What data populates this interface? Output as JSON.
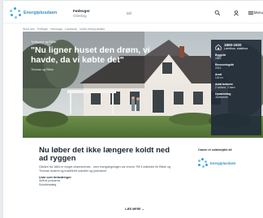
{
  "header": {
    "logo_text": "Energiplusdaen",
    "nav_primary": "Fødevger",
    "nav_primary_sub": "Glimling",
    "nav_secondary": "Bill",
    "menu_label": "Menu",
    "icons": [
      "search-icon",
      "user-icon",
      "menu-icon"
    ]
  },
  "breadcrumb": "Store fam · Poffmgle · Hembagd · Caseboek · Unifre Hemaj skiktier",
  "hero": {
    "category": "Tjeilkunne og Rikke",
    "quote": "\"Nu ligner huset den drøm, vi havde, da vi købte det\"",
    "author": "Thomas og Rikke",
    "facts": {
      "title": "1800-1920",
      "subtitle": "Landhus, staldhus",
      "items": [
        {
          "label": "Byggeår",
          "value": "1869"
        },
        {
          "label": "Renoveringsår",
          "value": "2012"
        },
        {
          "label": "Areal",
          "value": "140 m²"
        },
        {
          "label": "Antal beboere",
          "value": "2 voksne, 2 børn"
        },
        {
          "label": "Opvarmning",
          "value": "Jordvarme"
        }
      ]
    }
  },
  "article": {
    "heading": "Nu løber det ikke længere koldt ned ad ryggen",
    "lead": "Gården fra 1864 er meget charmerende - men energiregningen var enorm. På 3 måneder fik Rikke og Thomas isoleret og installeret solceller og jordvarme.",
    "list_title": "Liste over forbedringer:",
    "list_items": [
      "Skift af jordvarme",
      "Solcelleanlæg"
    ]
  },
  "aside": {
    "title": "Casen er udarbejdet af:",
    "logo_text": "Energiplusdaen"
  },
  "more_label": "LÆS MERE ⌄"
}
